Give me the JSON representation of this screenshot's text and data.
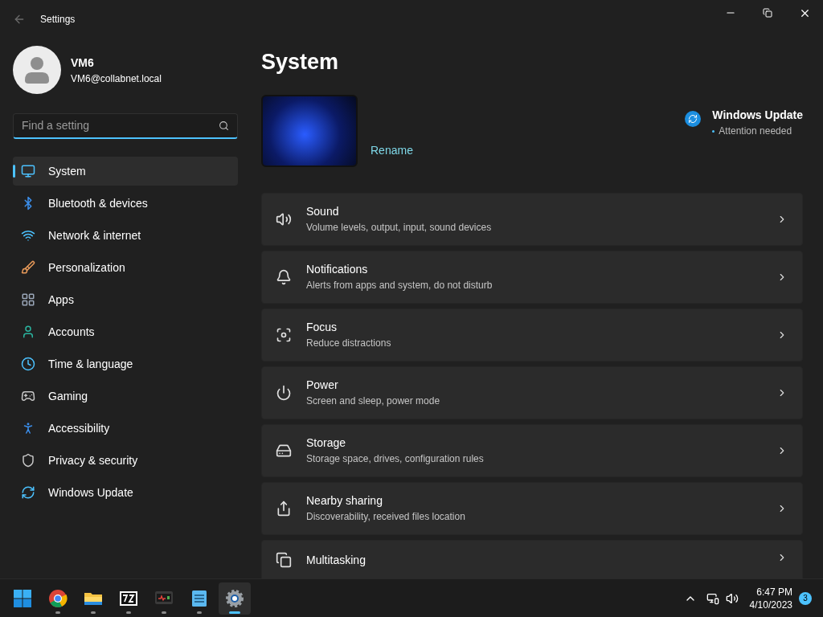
{
  "window": {
    "title": "Settings"
  },
  "account": {
    "name": "VM6",
    "email": "VM6@collabnet.local"
  },
  "search": {
    "placeholder": "Find a setting"
  },
  "nav": [
    {
      "label": "System",
      "selected": true
    },
    {
      "label": "Bluetooth & devices",
      "selected": false
    },
    {
      "label": "Network & internet",
      "selected": false
    },
    {
      "label": "Personalization",
      "selected": false
    },
    {
      "label": "Apps",
      "selected": false
    },
    {
      "label": "Accounts",
      "selected": false
    },
    {
      "label": "Time & language",
      "selected": false
    },
    {
      "label": "Gaming",
      "selected": false
    },
    {
      "label": "Accessibility",
      "selected": false
    },
    {
      "label": "Privacy & security",
      "selected": false
    },
    {
      "label": "Windows Update",
      "selected": false
    }
  ],
  "page": {
    "title": "System",
    "rename": "Rename",
    "update": {
      "title": "Windows Update",
      "status": "Attention needed"
    }
  },
  "cards": [
    {
      "title": "Sound",
      "description": "Volume levels, output, input, sound devices"
    },
    {
      "title": "Notifications",
      "description": "Alerts from apps and system, do not disturb"
    },
    {
      "title": "Focus",
      "description": "Reduce distractions"
    },
    {
      "title": "Power",
      "description": "Screen and sleep, power mode"
    },
    {
      "title": "Storage",
      "description": "Storage space, drives, configuration rules"
    },
    {
      "title": "Nearby sharing",
      "description": "Discoverability, received files location"
    },
    {
      "title": "Multitasking"
    }
  ],
  "taskbar": {
    "apps": [
      {
        "selected": false
      },
      {
        "selected": false
      },
      {
        "selected": false
      },
      {
        "selected": false
      },
      {
        "selected": false
      },
      {
        "selected": true
      }
    ],
    "tray": {
      "time": "6:47 PM",
      "date": "4/10/2023",
      "badge": "3"
    }
  }
}
